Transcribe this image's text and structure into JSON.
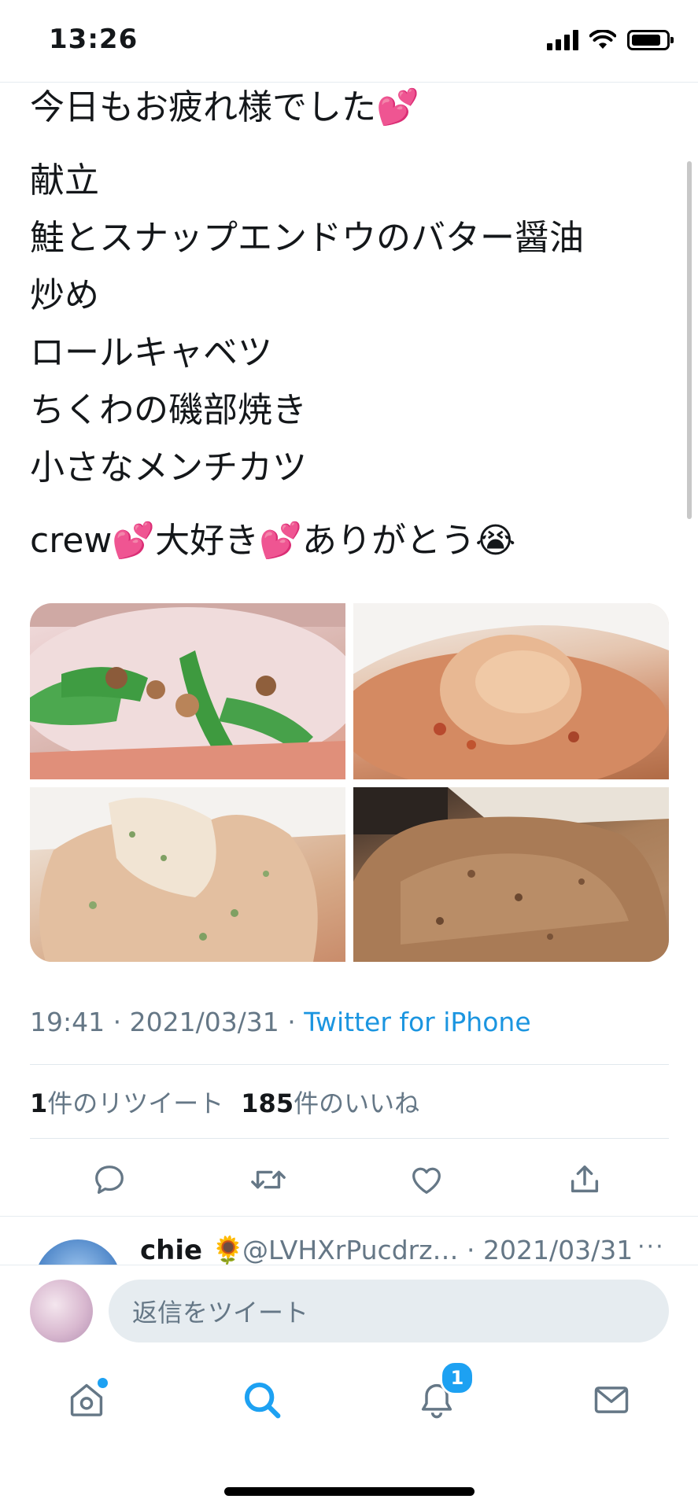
{
  "status_bar": {
    "time": "13:26"
  },
  "tweet": {
    "lines_top": [
      "今日もお疲れ様でした💕"
    ],
    "menu_lines": [
      "献立",
      "鮭とスナップエンドウのバター醤油",
      "炒め",
      "ロールキャベツ",
      "ちくわの磯部焼き",
      "小さなメンチカツ"
    ],
    "closing_line": "crew💕大好き💕ありがとう😭",
    "photos": [
      {
        "alt": "鮭とスナップエンドウのバター醤油炒め"
      },
      {
        "alt": "ロールキャベツ"
      },
      {
        "alt": "ちくわの磯部焼き"
      },
      {
        "alt": "小さなメンチカツ"
      }
    ],
    "meta": {
      "time": "19:41",
      "sep1": " · ",
      "date": "2021/03/31",
      "sep2": " · ",
      "source": "Twitter for iPhone"
    },
    "retweets": {
      "count": "1",
      "label": "件のリツイート"
    },
    "likes": {
      "count": "185",
      "label": "件のいいね"
    }
  },
  "actions": {
    "reply_icon": "reply-icon",
    "retweet_icon": "retweet-icon",
    "like_icon": "heart-icon",
    "share_icon": "share-icon"
  },
  "reply_preview": {
    "name": "chie 🌻",
    "handle_date": "@LVHXrPucdrz… · 2021/03/31",
    "more": "···"
  },
  "composer": {
    "placeholder": "返信をツイート"
  },
  "tabbar": {
    "notifications_badge": "1"
  },
  "colors": {
    "accent": "#1da1f2",
    "link": "#1b95e0",
    "secondary_text": "#657786"
  }
}
